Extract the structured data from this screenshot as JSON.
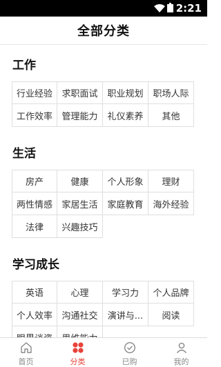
{
  "status_bar": {
    "time": "2:21"
  },
  "header": {
    "title": "全部分类"
  },
  "sections": [
    {
      "title": "工作",
      "items": [
        "行业经验",
        "求职面试",
        "职业规划",
        "职场人际",
        "工作效率",
        "管理能力",
        "礼仪素养",
        "其他"
      ]
    },
    {
      "title": "生活",
      "items": [
        "房产",
        "健康",
        "个人形象",
        "理财",
        "两性情感",
        "家居生活",
        "家庭教育",
        "海外经验",
        "法律",
        "兴趣技巧"
      ]
    },
    {
      "title": "学习成长",
      "items": [
        "英语",
        "心理",
        "学习力",
        "个人品牌",
        "个人效率",
        "沟通社交",
        "演讲与...",
        "阅读",
        "眼界谈资",
        "思维能力"
      ]
    }
  ],
  "tabbar": {
    "active": "分类",
    "tabs": [
      {
        "label": "首页",
        "icon": "home-icon"
      },
      {
        "label": "分类",
        "icon": "category-icon"
      },
      {
        "label": "已购",
        "icon": "purchased-icon"
      },
      {
        "label": "我的",
        "icon": "profile-icon"
      }
    ]
  },
  "colors": {
    "accent": "#e8433a",
    "grid_border": "#dedede"
  }
}
